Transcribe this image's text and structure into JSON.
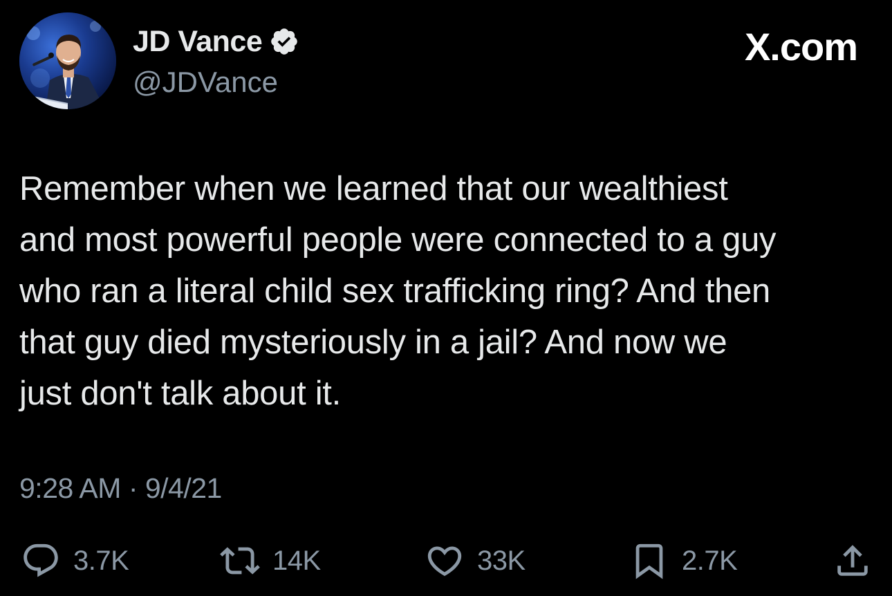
{
  "header": {
    "display_name": "JD Vance",
    "handle": "@JDVance",
    "verified": true,
    "brand": "X.com"
  },
  "tweet": {
    "text": "Remember when we learned that our wealthiest\nand most powerful people were connected to a guy\nwho ran a literal child sex trafficking ring? And then\nthat guy died mysteriously in a jail? And now we\njust don't talk about it.",
    "timestamp": "9:28 AM · 9/4/21"
  },
  "actions": {
    "replies": "3.7K",
    "reposts": "14K",
    "likes": "33K",
    "bookmarks": "2.7K"
  },
  "icons": {
    "reply": "reply-icon",
    "repost": "repost-icon",
    "like": "like-icon",
    "bookmark": "bookmark-icon",
    "share": "share-icon",
    "verified": "verified-badge-icon"
  },
  "colors": {
    "background": "#000000",
    "primary_text": "#e7e9ea",
    "secondary_text": "#8b98a5"
  }
}
